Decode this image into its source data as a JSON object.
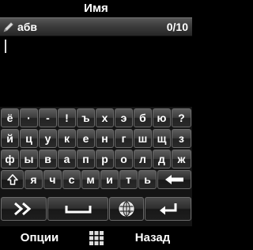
{
  "window": {
    "title": "Имя"
  },
  "field": {
    "value": "абв",
    "counter": "0/10"
  },
  "keyboard": {
    "rows": [
      [
        "ё",
        "·",
        "-",
        "!",
        "ъ",
        "х",
        "э",
        "б",
        "ю",
        "?"
      ],
      [
        "й",
        "ц",
        "у",
        "к",
        "е",
        "н",
        "г",
        "ш",
        "щ",
        "з"
      ],
      [
        "ф",
        "ы",
        "в",
        "а",
        "п",
        "р",
        "о",
        "л",
        "д",
        "ж"
      ],
      [
        "я",
        "ч",
        "с",
        "м",
        "и",
        "т",
        "ь"
      ]
    ],
    "icons": {
      "shift": "shift-up-arrow-icon",
      "backspace": "backspace-arrow-icon",
      "mode": "double-chevron-right-icon",
      "space": "space-bar-icon",
      "input_language": "globe-icon",
      "enter": "enter-return-icon"
    }
  },
  "softkeys": {
    "left": "Опции",
    "right": "Назад",
    "center_icon": "menu-grid-icon"
  }
}
